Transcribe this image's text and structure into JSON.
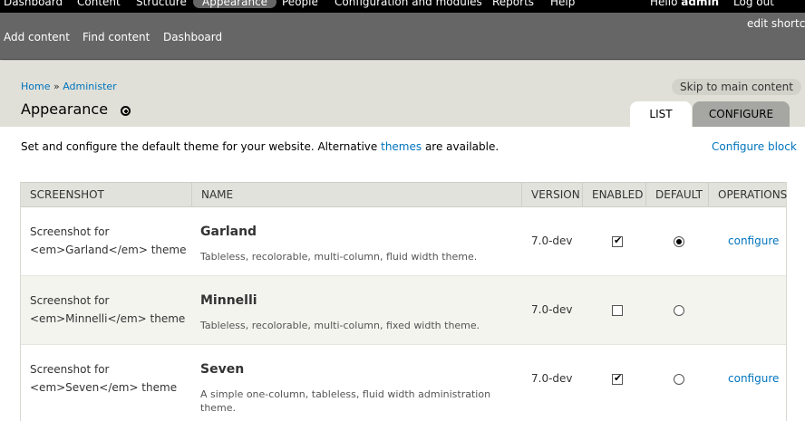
{
  "toolbar": {
    "menu": [
      "Dashboard",
      "Content",
      "Structure",
      "Appearance",
      "People",
      "Configuration and modules",
      "Reports",
      "Help"
    ],
    "active_menu": "Appearance",
    "hello": "Hello",
    "username": "admin",
    "logout": "Log out"
  },
  "shortcuts": {
    "items": [
      "Add content",
      "Find content",
      "Dashboard"
    ],
    "edit": "edit shortcuts"
  },
  "header": {
    "breadcrumb": [
      "Home",
      "Administer"
    ],
    "breadcrumb_separator": "»",
    "title": "Appearance",
    "skip_link": "Skip to main content",
    "tabs": [
      "LIST",
      "CONFIGURE"
    ]
  },
  "content": {
    "intro_before": "Set and configure the default theme for your website. Alternative ",
    "intro_link": "themes",
    "intro_after": " are available.",
    "configure_block": "Configure block"
  },
  "table": {
    "headers": [
      "SCREENSHOT",
      "NAME",
      "VERSION",
      "ENABLED",
      "DEFAULT",
      "OPERATIONS"
    ],
    "rows": [
      {
        "screenshot_line1": "Screenshot for",
        "screenshot_line2": "<em>Garland</em> theme",
        "name": "Garland",
        "description": "Tableless, recolorable, multi-column, fluid width theme.",
        "version": "7.0-dev",
        "enabled": true,
        "default": true,
        "operation": "configure"
      },
      {
        "screenshot_line1": "Screenshot for",
        "screenshot_line2": "<em>Minnelli</em> theme",
        "name": "Minnelli",
        "description": "Tableless, recolorable, multi-column, fixed width theme.",
        "version": "7.0-dev",
        "enabled": false,
        "default": false,
        "operation": ""
      },
      {
        "screenshot_line1": "Screenshot for",
        "screenshot_line2": "<em>Seven</em> theme",
        "name": "Seven",
        "description": "A simple one-column, tableless, fluid width administration theme.",
        "version": "7.0-dev",
        "enabled": true,
        "default": false,
        "operation": "configure"
      }
    ]
  }
}
